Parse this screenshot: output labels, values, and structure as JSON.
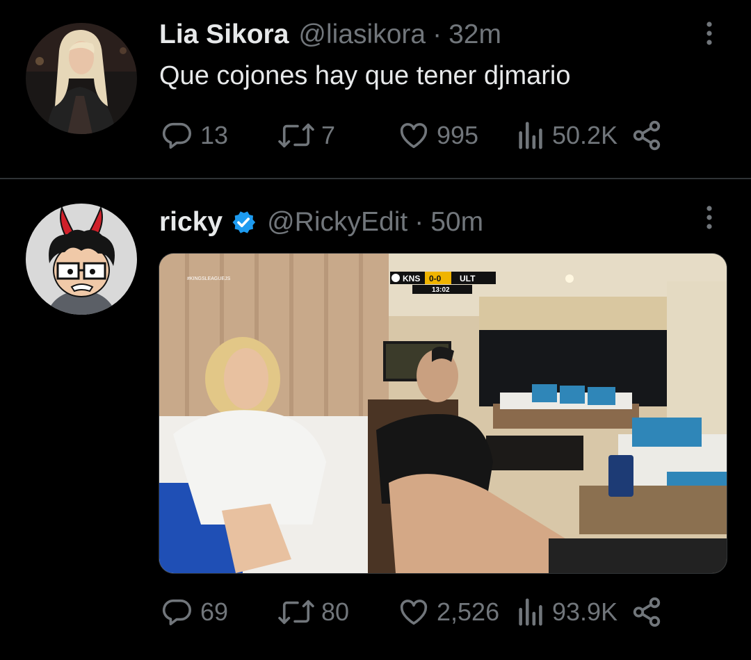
{
  "tweets": [
    {
      "author_name": "Lia Sikora",
      "handle": "@liasikora",
      "separator": "·",
      "time": "32m",
      "text": "Que cojones hay que tener djmario",
      "stats": {
        "replies": "13",
        "retweets": "7",
        "likes": "995",
        "views": "50.2K"
      }
    },
    {
      "author_name": "ricky",
      "verified": true,
      "handle": "@RickyEdit",
      "separator": "·",
      "time": "50m",
      "media": {
        "overlay_brand": "#KINGSLEAGUEJS",
        "scoreboard": {
          "home": "KNS",
          "score": "0-0",
          "away": "ULT",
          "clock": "13:02"
        }
      },
      "stats": {
        "replies": "69",
        "retweets": "80",
        "likes": "2,526",
        "views": "93.9K"
      }
    }
  ],
  "colors": {
    "background": "#000000",
    "primary_text": "#e7e9ea",
    "secondary_text": "#71767b",
    "verified": "#1d9bf0",
    "divider": "#2f3336"
  },
  "icons": [
    "reply-icon",
    "retweet-icon",
    "like-icon",
    "views-icon",
    "share-icon",
    "more-options-icon",
    "verified-badge-icon"
  ]
}
